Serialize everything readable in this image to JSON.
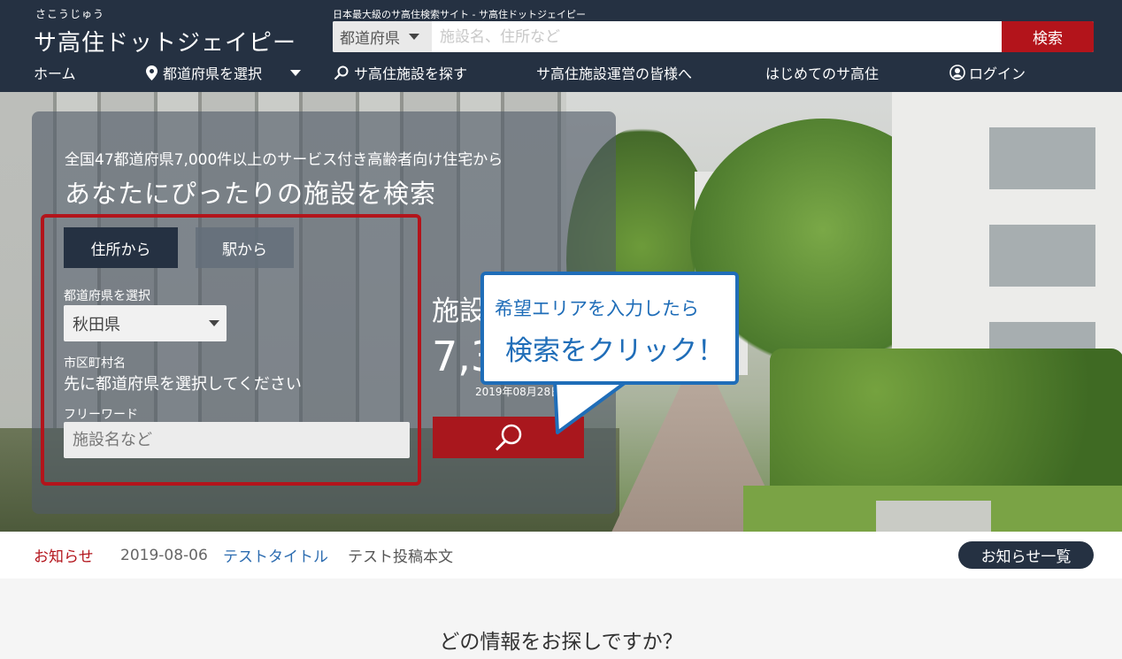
{
  "header": {
    "logo_ruby": "さこうじゅう",
    "logo": "サ高住ドットジェイピー",
    "tagline": "日本最大級のサ高住検索サイト - サ高住ドットジェイピー",
    "search": {
      "prefecture_select": "都道府県",
      "placeholder": "施設名、住所など",
      "button": "検索"
    },
    "nav": {
      "home": "ホーム",
      "prefecture": "都道府県を選択",
      "find": "サ高住施設を探す",
      "operators": "サ高住施設運営の皆様へ",
      "beginners": "はじめてのサ高住",
      "login": "ログイン"
    }
  },
  "hero": {
    "subtitle": "全国47都道府県7,000件以上のサービス付き高齢者向け住宅から",
    "title": "あなたにぴったりの施設を検索",
    "tabs": [
      "住所から",
      "駅から"
    ],
    "prefecture_label": "都道府県を選択",
    "prefecture_value": "秋田県",
    "city_label": "市区町村名",
    "city_message": "先に都道府県を選択してください",
    "freeword_label": "フリーワード",
    "freeword_placeholder": "施設名など",
    "count_label": "施設",
    "count_value": "7,3",
    "updated": "2019年08月28日 更新",
    "callout_line1": "希望エリアを入力したら",
    "callout_line2": "検索をクリック！"
  },
  "news": {
    "label": "お知らせ",
    "date": "2019-08-06",
    "title": "テストタイトル",
    "body": "テスト投稿本文",
    "list_button": "お知らせ一覧"
  },
  "section": {
    "title": "どの情報をお探しですか？"
  },
  "colors": {
    "navy": "#253142",
    "red": "#b3141b",
    "blue": "#1f6db8"
  }
}
